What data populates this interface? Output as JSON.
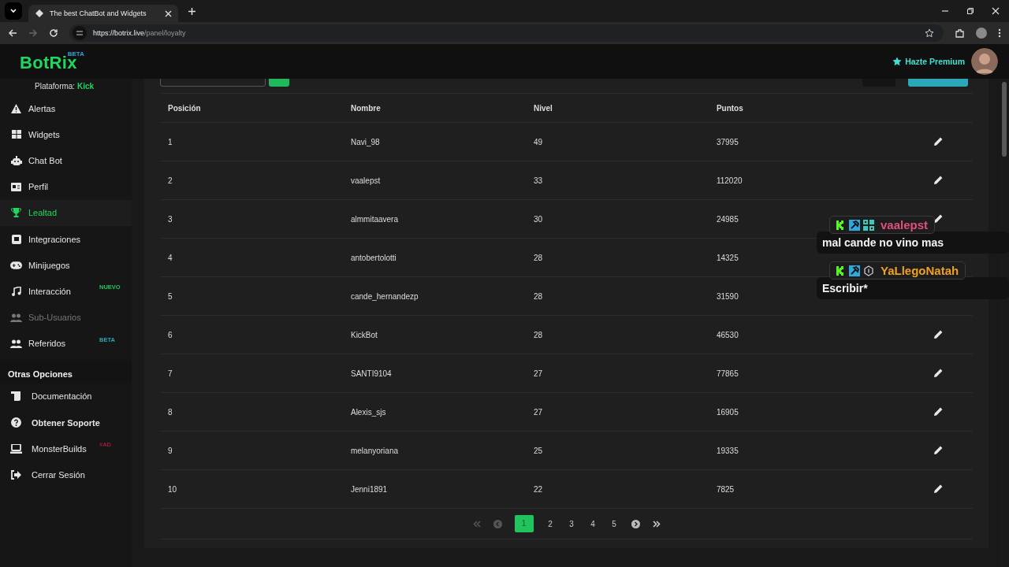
{
  "browser": {
    "tab_title": "The best ChatBot and Widgets",
    "url_host": "https://botrix.live",
    "url_path": "/panel/loyalty"
  },
  "header": {
    "logo": "BotRix",
    "logo_badge": "BETA",
    "premium": "Hazte Premium"
  },
  "sidebar": {
    "platform_label": "Plataforma:",
    "platform": "Kick",
    "items": [
      {
        "label": "Alertas",
        "selected": false,
        "disabled": false
      },
      {
        "label": "Widgets",
        "selected": false,
        "disabled": false
      },
      {
        "label": "Chat Bot",
        "selected": false,
        "disabled": false
      },
      {
        "label": "Perfil",
        "selected": false,
        "disabled": false
      },
      {
        "label": "Lealtad",
        "selected": true,
        "disabled": false
      },
      {
        "label": "Integraciones",
        "selected": false,
        "disabled": false
      },
      {
        "label": "Minijuegos",
        "selected": false,
        "disabled": false
      },
      {
        "label": "Interacción",
        "selected": false,
        "disabled": false,
        "badge": "NUEVO",
        "color": "#22c55e"
      },
      {
        "label": "Sub-Usuarios",
        "selected": false,
        "disabled": true
      },
      {
        "label": "Referidos",
        "selected": false,
        "disabled": false,
        "badge": "BETA",
        "color": "#2aa7b8"
      }
    ],
    "section_title": "Otras Opciones",
    "other_items": [
      {
        "label": "Documentación"
      },
      {
        "label": "Obtener Soporte"
      },
      {
        "label": "MonsterBuilds",
        "badge": "#AD",
        "color": "#9b1c3a"
      },
      {
        "label": "Cerrar Sesión"
      }
    ]
  },
  "table": {
    "columns": [
      "Posición",
      "Nombre",
      "Nivel",
      "Puntos"
    ],
    "rows": [
      [
        "1",
        "Navi_98",
        "49",
        "37995"
      ],
      [
        "2",
        "vaalepst",
        "33",
        "112020"
      ],
      [
        "3",
        "almmitaavera",
        "30",
        "24985"
      ],
      [
        "4",
        "antobertolotti",
        "28",
        "14325"
      ],
      [
        "5",
        "cande_hernandezp",
        "28",
        "31590"
      ],
      [
        "6",
        "KickBot",
        "28",
        "46530"
      ],
      [
        "7",
        "SANTI9104",
        "27",
        "77865"
      ],
      [
        "8",
        "Alexis_sjs",
        "27",
        "16905"
      ],
      [
        "9",
        "melanyoriana",
        "25",
        "19335"
      ],
      [
        "10",
        "Jenni1891",
        "22",
        "7825"
      ]
    ]
  },
  "pagination": {
    "pages": [
      {
        "label": "1",
        "selected": true
      },
      {
        "label": "2",
        "selected": false
      },
      {
        "label": "3",
        "selected": false
      },
      {
        "label": "4",
        "selected": false
      },
      {
        "label": "5",
        "selected": false
      }
    ]
  },
  "chat_overlay": [
    {
      "user": "vaalepst",
      "color": "#e0507a",
      "message": "mal cande no vino mas",
      "badges": [
        {
          "kind": "kick"
        },
        {
          "kind": "mod"
        },
        {
          "kind": "gift"
        }
      ]
    },
    {
      "user": "YaLlegoNatah",
      "color": "#f0a020",
      "message": "Escribir*",
      "badges": [
        {
          "kind": "kick"
        },
        {
          "kind": "mod"
        },
        {
          "kind": "sub"
        }
      ]
    }
  ]
}
